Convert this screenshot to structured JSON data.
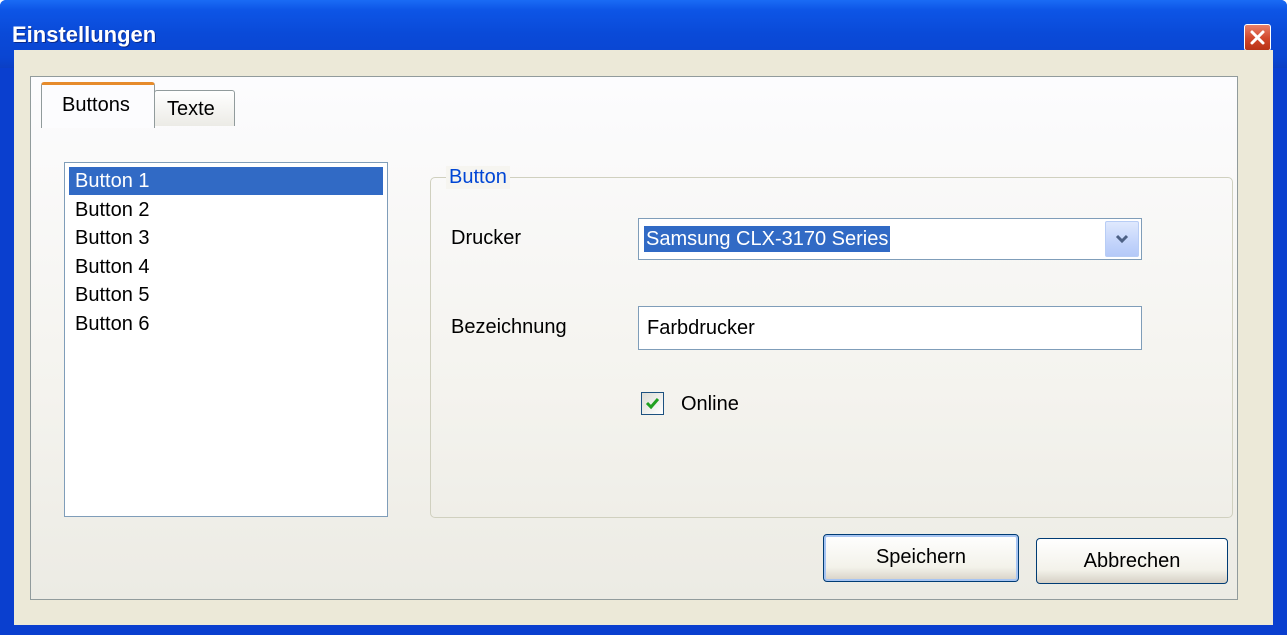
{
  "window": {
    "title": "Einstellungen"
  },
  "tabs": [
    {
      "label": "Buttons",
      "active": true
    },
    {
      "label": "Texte",
      "active": false
    }
  ],
  "button_list": {
    "items": [
      "Button 1",
      "Button 2",
      "Button 3",
      "Button 4",
      "Button 5",
      "Button 6"
    ],
    "selected": "Button 1"
  },
  "group": {
    "title": "Button",
    "printer_label": "Drucker",
    "printer_value": "Samsung CLX-3170 Series",
    "name_label": "Bezeichnung",
    "name_value": "Farbdrucker",
    "online_label": "Online",
    "online_checked": true
  },
  "actions": {
    "save_label": "Speichern",
    "cancel_label": "Abbrechen"
  },
  "colors": {
    "titlebar": "#0a4ad8",
    "selection": "#316ac5",
    "group_title": "#0046d5",
    "client_bg": "#ece9d8"
  }
}
